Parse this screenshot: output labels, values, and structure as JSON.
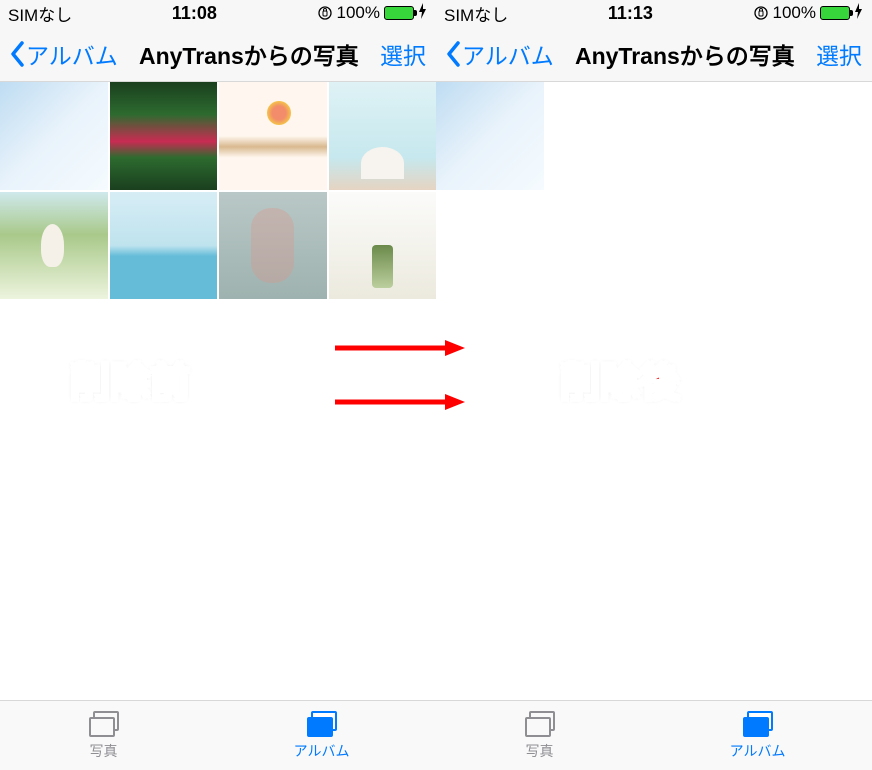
{
  "left": {
    "status": {
      "carrier": "SIMなし",
      "time": "11:08",
      "battery": "100%"
    },
    "nav": {
      "back": "アルバム",
      "title": "AnyTransからの写真",
      "select": "選択"
    },
    "photo_count": 8,
    "tabs": {
      "photos": "写真",
      "albums": "アルバム"
    }
  },
  "right": {
    "status": {
      "carrier": "SIMなし",
      "time": "11:13",
      "battery": "100%"
    },
    "nav": {
      "back": "アルバム",
      "title": "AnyTransからの写真",
      "select": "選択"
    },
    "photo_count": 1,
    "tabs": {
      "photos": "写真",
      "albums": "アルバム"
    }
  },
  "annotations": {
    "before": "削除前",
    "after": "削除後"
  },
  "colors": {
    "accent": "#007aff",
    "red": "#ff0000",
    "battery": "#37d63a"
  }
}
